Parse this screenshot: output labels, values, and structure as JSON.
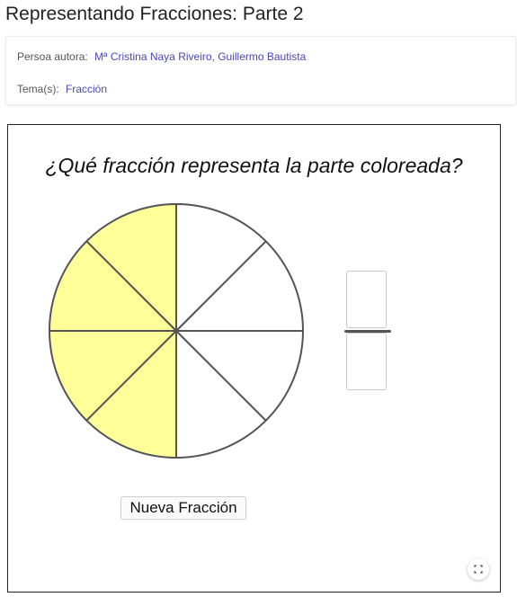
{
  "page": {
    "title": "Representando Fracciones: Parte 2"
  },
  "info": {
    "author_label": "Persoa autora:",
    "author_value": "Mª Cristina Naya Riveiro, Guillermo Bautista",
    "topic_label": "Tema(s):",
    "topic_value": "Fracción"
  },
  "applet": {
    "question": "¿Qué fracción representa la parte coloreada?",
    "circle": {
      "total_parts": 8,
      "shaded_parts": 4,
      "shaded_color": "#ffff99",
      "unshaded_color": "#ffffff"
    },
    "numerator_input": "",
    "denominator_input": "",
    "new_button_label": "Nueva Fracción",
    "fullscreen_icon": "expand-icon"
  }
}
